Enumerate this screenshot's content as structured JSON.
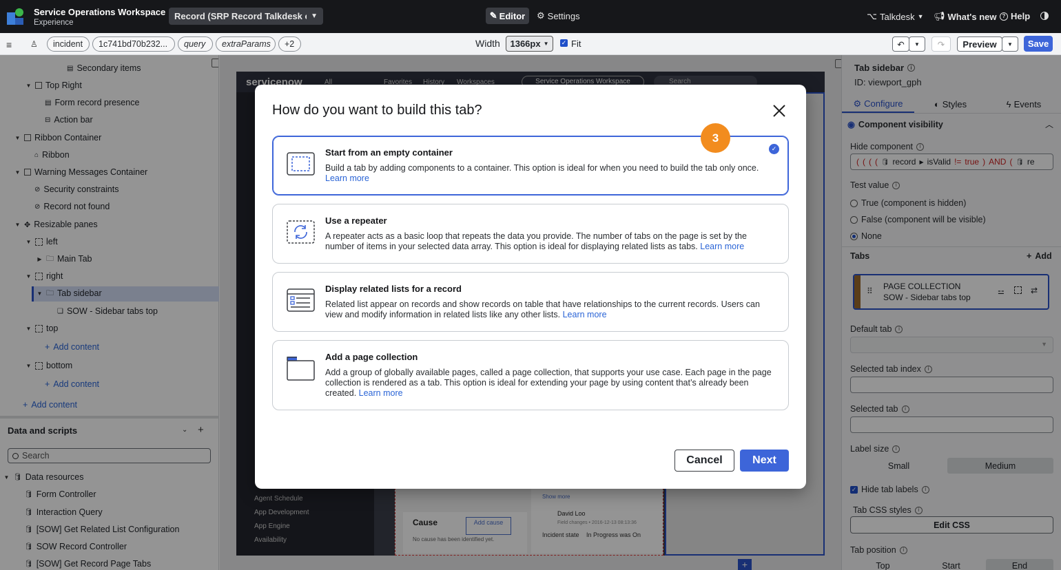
{
  "header": {
    "app_title": "Service Operations Workspace",
    "app_subtitle": "Experience",
    "record_dropdown": "Record (SRP Record Talkdesk c...",
    "editor_tab": "Editor",
    "settings_tab": "Settings",
    "talkdesk_menu": "Talkdesk",
    "whats_new": "What's new",
    "help": "Help"
  },
  "toolbar": {
    "pills": [
      "incident",
      "1c741bd70b232...",
      "query",
      "extraParams",
      "+2"
    ],
    "width_label": "Width",
    "width_value": "1366px",
    "fit_label": "Fit",
    "fit_checked": true,
    "preview_label": "Preview",
    "save_label": "Save"
  },
  "left_panel": {
    "tree": [
      "Secondary items",
      "Top Right",
      "Form record presence",
      "Action bar",
      "Ribbon Container",
      "Ribbon",
      "Warning Messages Container",
      "Security constraints",
      "Record not found",
      "Resizable panes",
      "left",
      "Main Tab",
      "right",
      "Tab sidebar",
      "SOW - Sidebar tabs top",
      "top",
      "Add content",
      "bottom",
      "Add content",
      "Add content"
    ],
    "data_scripts_title": "Data and scripts",
    "search_placeholder": "Search",
    "data_resources_label": "Data resources",
    "data_resources": [
      "Form Controller",
      "Interaction Query",
      "[SOW] Get Related List Configuration",
      "SOW Record Controller",
      "[SOW] Get Record Page Tabs"
    ]
  },
  "preview": {
    "logo": "servicenow",
    "nav": [
      "All",
      "Favorites",
      "History",
      "Workspaces"
    ],
    "workspace_pill": "Service Operations Workspace",
    "search": "Search",
    "sidebar_items": [
      "Agent Schedule",
      "App Development",
      "App Engine",
      "Availability"
    ],
    "show_more": "Show more",
    "cause_title": "Cause",
    "add_cause": "Add cause",
    "cause_empty": "No cause has been identified yet.",
    "user_name": "David Loo",
    "field_changes": "Field changes • 2016-12-13 08:13:36",
    "incident_state_label": "Incident state",
    "incident_state_value": "In Progress was On"
  },
  "right_panel": {
    "title": "Tab sidebar",
    "id_label": "ID: viewport_gph",
    "tabs": [
      "Configure",
      "Styles",
      "Events"
    ],
    "active_tab": "Configure",
    "component_visibility": "Component visibility",
    "hide_component_label": "Hide component",
    "hide_component_tokens": [
      "(",
      "(",
      "(",
      "(",
      "record",
      "isValid",
      "!=",
      "true",
      ")",
      "AND",
      "(",
      "re"
    ],
    "test_value_label": "Test value",
    "radio_options": [
      "True (component is hidden)",
      "False (component will be visible)",
      "None"
    ],
    "radio_selected": "None",
    "tabs_section": "Tabs",
    "add_label": "Add",
    "tab_card_title": "PAGE COLLECTION",
    "tab_card_subtitle": "SOW - Sidebar tabs top",
    "default_tab_label": "Default tab",
    "selected_tab_index_label": "Selected tab index",
    "selected_tab_label": "Selected tab",
    "label_size_label": "Label size",
    "label_size_options": [
      "Small",
      "Medium"
    ],
    "label_size_selected": "Medium",
    "hide_tab_labels": "Hide tab labels",
    "hide_tab_labels_checked": true,
    "tab_css_styles": "Tab CSS styles",
    "edit_css": "Edit CSS",
    "tab_position_label": "Tab position",
    "tab_position_options": [
      "Top",
      "Start",
      "End"
    ],
    "tab_position_selected": "End"
  },
  "modal": {
    "title": "How do you want to build this tab?",
    "step_badge": "3",
    "options": [
      {
        "title": "Start from an empty container",
        "description": "Build a tab by adding components to a container. This option is ideal for when you need to build the tab only once.",
        "learn_more": "Learn more",
        "selected": true
      },
      {
        "title": "Use a repeater",
        "description": "A repeater acts as a basic loop that repeats the data you provide. The number of tabs on the page is set by the number of items in your selected data array. This option is ideal for displaying related lists as tabs.",
        "learn_more": "Learn more",
        "selected": false
      },
      {
        "title": "Display related lists for a record",
        "description": "Related list appear on records and show records on table that have relationships to the current records. Users can view and modify information in related lists like any other lists.",
        "learn_more": "Learn more",
        "selected": false
      },
      {
        "title": "Add a page collection",
        "description": "Add a group of globally available pages, called a page collection, that supports your use case. Each page in the page collection is rendered as a tab. This option is ideal for extending your page by using content that’s already been created.",
        "learn_more": "Learn more",
        "selected": false
      }
    ],
    "cancel_label": "Cancel",
    "next_label": "Next"
  },
  "colors": {
    "accent": "#3d65d9",
    "header_bg": "#16171a",
    "badge_orange": "#f28c1e",
    "next_button": "#3d65d9"
  }
}
